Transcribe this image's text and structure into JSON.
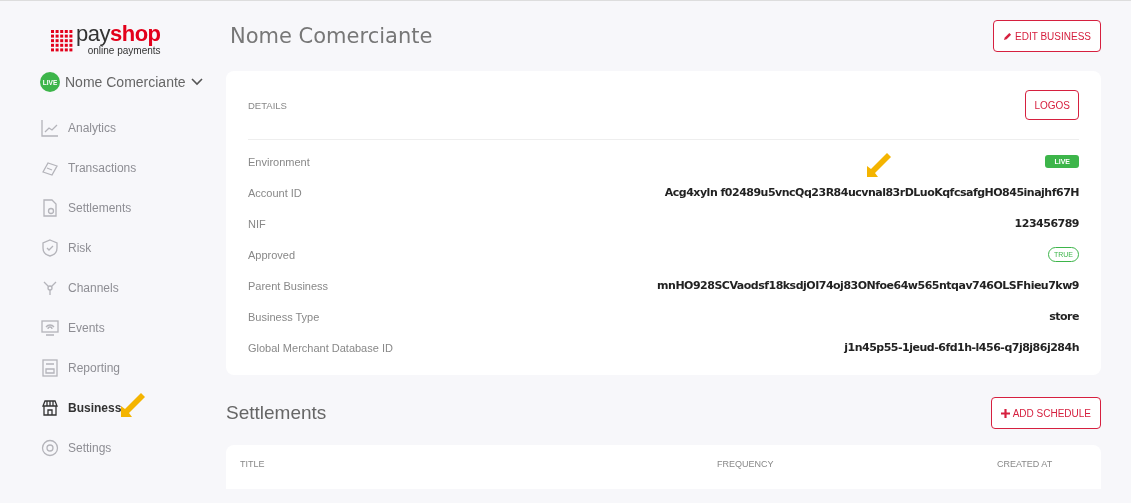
{
  "logo": {
    "name_part1": "pay",
    "name_part2": "shop",
    "tagline": "online payments"
  },
  "account": {
    "badge": "LIVE",
    "name": "Nome Comerciante"
  },
  "sidebar": {
    "items": [
      {
        "label": "Analytics",
        "selected": false
      },
      {
        "label": "Transactions",
        "selected": false
      },
      {
        "label": "Settlements",
        "selected": false
      },
      {
        "label": "Risk",
        "selected": false
      },
      {
        "label": "Channels",
        "selected": false
      },
      {
        "label": "Events",
        "selected": false
      },
      {
        "label": "Reporting",
        "selected": false
      },
      {
        "label": "Business",
        "selected": true
      },
      {
        "label": "Settings",
        "selected": false
      }
    ]
  },
  "business": {
    "title": "Nome Comerciante",
    "edit_button": "EDIT BUSINESS",
    "details": {
      "heading": "DETAILS",
      "logos_button": "LOGOS",
      "rows": [
        {
          "label": "Environment",
          "value": "LIVE",
          "kind": "live"
        },
        {
          "label": "Account ID",
          "value": "Acg4xyln f02489u5vncQq23R84ucvnal83rDLuoKqfcsafgHO845inajhf67H",
          "kind": "text"
        },
        {
          "label": "NIF",
          "value": "123456789",
          "kind": "text"
        },
        {
          "label": "Approved",
          "value": "TRUE",
          "kind": "pill"
        },
        {
          "label": "Parent Business",
          "value": "mnHO928SCVaodsf18ksdjOI74oj83ONfoe64w565ntqav746OLSFhieu7kw9",
          "kind": "text"
        },
        {
          "label": "Business Type",
          "value": "store",
          "kind": "text"
        },
        {
          "label": "Global Merchant Database ID",
          "value": "j1n45p55-1jeud-6fd1h-l456-q7j8j86j284h",
          "kind": "text"
        }
      ]
    }
  },
  "settlements": {
    "title": "Settlements",
    "add_button": "ADD SCHEDULE",
    "columns": [
      "TITLE",
      "FREQUENCY",
      "CREATED AT"
    ]
  }
}
